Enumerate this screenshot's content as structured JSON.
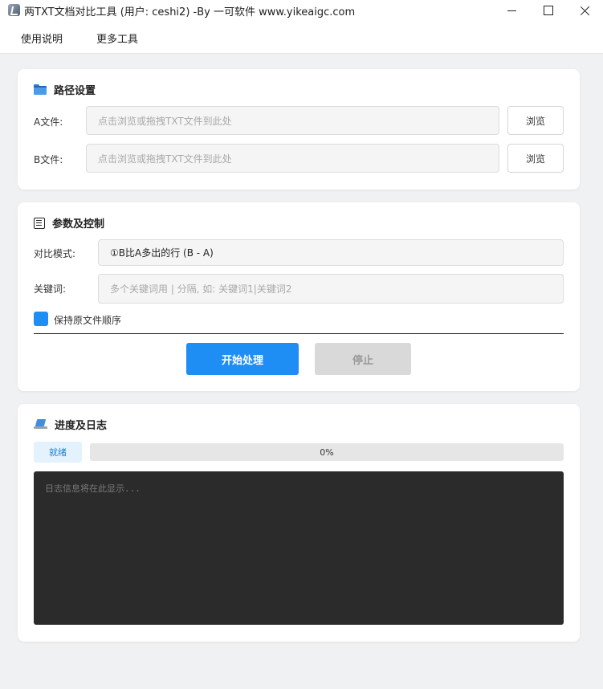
{
  "window": {
    "title": "两TXT文档对比工具 (用户: ceshi2) -By 一可软件 www.yikeaigc.com",
    "icon": "app-icon"
  },
  "menu": {
    "items": [
      {
        "label": "使用说明"
      },
      {
        "label": "更多工具"
      }
    ]
  },
  "path_settings": {
    "title": "路径设置",
    "icon": "folder-icon",
    "file_a": {
      "label": "A文件:",
      "placeholder": "点击浏览或拖拽TXT文件到此处",
      "browse_label": "浏览"
    },
    "file_b": {
      "label": "B文件:",
      "placeholder": "点击浏览或拖拽TXT文件到此处",
      "browse_label": "浏览"
    }
  },
  "params": {
    "title": "参数及控制",
    "icon": "list-icon",
    "mode_label": "对比模式:",
    "mode_value": "①B比A多出的行 (B - A)",
    "keyword_label": "关键词:",
    "keyword_placeholder": "多个关键词用 | 分隔, 如: 关键词1|关键词2",
    "keep_order_label": "保持原文件顺序",
    "keep_order_checked": true,
    "start_label": "开始处理",
    "stop_label": "停止",
    "accent_color": "#1e8ef5"
  },
  "log": {
    "title": "进度及日志",
    "icon": "laptop-icon",
    "status": "就绪",
    "progress": 0,
    "progress_text": "0%",
    "log_placeholder": "日志信息将在此显示..."
  }
}
